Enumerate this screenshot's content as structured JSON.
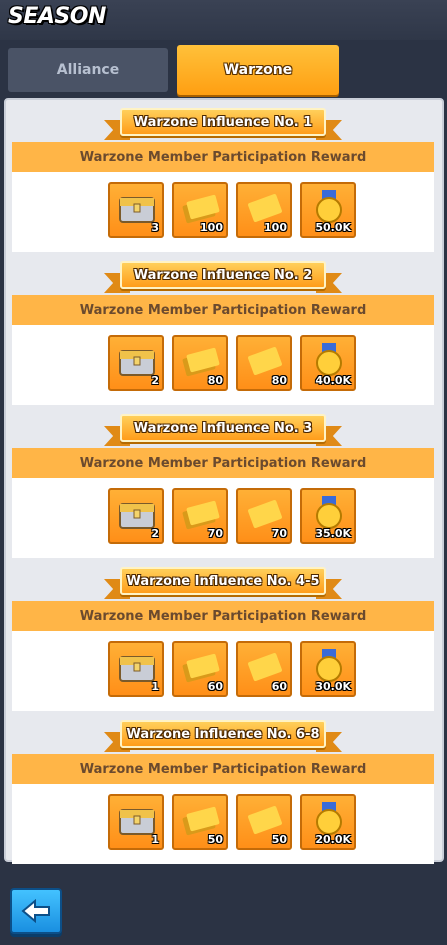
{
  "header": {
    "title": "SEASON"
  },
  "tabs": [
    {
      "label": "Alliance",
      "active": false
    },
    {
      "label": "Warzone",
      "active": true
    }
  ],
  "sections": [
    {
      "title": "Warzone Influence No. 1",
      "subtitle": "Warzone Member Participation Reward",
      "rewards": [
        {
          "icon": "treasure-chest-icon",
          "qty": "3"
        },
        {
          "icon": "gold-ticket-stack-icon",
          "qty": "100"
        },
        {
          "icon": "gold-ticket-icon",
          "qty": "100"
        },
        {
          "icon": "gold-medal-icon",
          "qty": "50.0K"
        }
      ]
    },
    {
      "title": "Warzone Influence No. 2",
      "subtitle": "Warzone Member Participation Reward",
      "rewards": [
        {
          "icon": "treasure-chest-icon",
          "qty": "2"
        },
        {
          "icon": "gold-ticket-stack-icon",
          "qty": "80"
        },
        {
          "icon": "gold-ticket-icon",
          "qty": "80"
        },
        {
          "icon": "gold-medal-icon",
          "qty": "40.0K"
        }
      ]
    },
    {
      "title": "Warzone Influence No. 3",
      "subtitle": "Warzone Member Participation Reward",
      "rewards": [
        {
          "icon": "treasure-chest-icon",
          "qty": "2"
        },
        {
          "icon": "gold-ticket-stack-icon",
          "qty": "70"
        },
        {
          "icon": "gold-ticket-icon",
          "qty": "70"
        },
        {
          "icon": "gold-medal-icon",
          "qty": "35.0K"
        }
      ]
    },
    {
      "title": "Warzone Influence No. 4-5",
      "subtitle": "Warzone Member Participation Reward",
      "rewards": [
        {
          "icon": "treasure-chest-icon",
          "qty": "1"
        },
        {
          "icon": "gold-ticket-stack-icon",
          "qty": "60"
        },
        {
          "icon": "gold-ticket-icon",
          "qty": "60"
        },
        {
          "icon": "gold-medal-icon",
          "qty": "30.0K"
        }
      ]
    },
    {
      "title": "Warzone Influence No. 6-8",
      "subtitle": "Warzone Member Participation Reward",
      "rewards": [
        {
          "icon": "treasure-chest-icon",
          "qty": "1"
        },
        {
          "icon": "gold-ticket-stack-icon",
          "qty": "50"
        },
        {
          "icon": "gold-ticket-icon",
          "qty": "50"
        },
        {
          "icon": "gold-medal-icon",
          "qty": "20.0K"
        }
      ]
    }
  ],
  "footer": {
    "back_icon": "back-arrow-icon"
  },
  "colors": {
    "background": "#2b3344",
    "accent_orange": "#ffa62b",
    "panel": "#e7e9ee",
    "back_button_blue": "#2aa4f0"
  }
}
